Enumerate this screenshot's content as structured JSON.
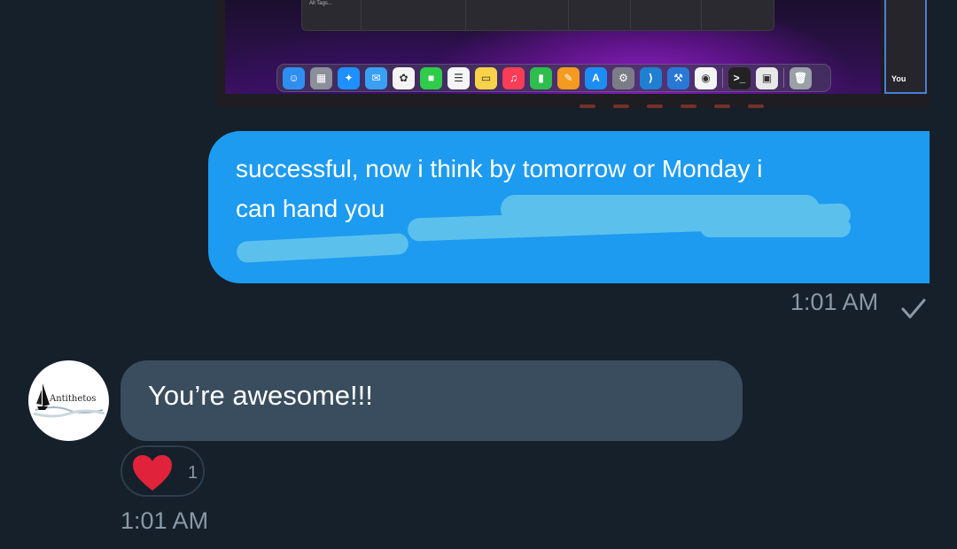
{
  "attachment": {
    "window_tag_text": "All Tags...",
    "thumbnail_label": "You",
    "dock_icons": [
      {
        "name": "finder-icon",
        "color": "#2f8ff0",
        "glyph": "☺"
      },
      {
        "name": "launchpad-icon",
        "color": "#8a8f99",
        "glyph": "▦"
      },
      {
        "name": "safari-icon",
        "color": "#1e90ff",
        "glyph": "✦"
      },
      {
        "name": "mail-icon",
        "color": "#3aa0f5",
        "glyph": "✉"
      },
      {
        "name": "photos-icon",
        "color": "#f4f4f4",
        "glyph": "✿"
      },
      {
        "name": "facetime-icon",
        "color": "#2ecc4a",
        "glyph": "■"
      },
      {
        "name": "reminders-icon",
        "color": "#f5f5f5",
        "glyph": "☰"
      },
      {
        "name": "notes-icon",
        "color": "#f7d24a",
        "glyph": "▭"
      },
      {
        "name": "music-icon",
        "color": "#fa3d56",
        "glyph": "♫"
      },
      {
        "name": "numbers-icon",
        "color": "#2dbe4e",
        "glyph": "▮"
      },
      {
        "name": "pages-icon",
        "color": "#f49a1e",
        "glyph": "✎"
      },
      {
        "name": "app-store-icon",
        "color": "#1c8ef2",
        "glyph": "A"
      },
      {
        "name": "system-settings-icon",
        "color": "#7a7d85",
        "glyph": "⚙"
      },
      {
        "name": "vscode-icon",
        "color": "#1f7fd0",
        "glyph": "⟩"
      },
      {
        "name": "xcode-icon",
        "color": "#2a78d6",
        "glyph": "⚒"
      },
      {
        "name": "chrome-icon",
        "color": "#f4f4f4",
        "glyph": "◉"
      },
      {
        "name": "terminal-icon",
        "color": "#222222",
        "glyph": ">_"
      },
      {
        "name": "preview-icon",
        "color": "#e8e8e8",
        "glyph": "▣"
      },
      {
        "name": "trash-icon",
        "color": "#9aa0a8",
        "glyph": "🗑"
      }
    ]
  },
  "outgoing": {
    "line1": "successful, now i think by tomorrow or Monday i",
    "line2_visible": "can hand you",
    "timestamp": "1:01 AM",
    "status_icon": "checkmark-icon",
    "bubble_color": "#1d9bf0",
    "redaction_color": "#5bc0ec"
  },
  "incoming": {
    "avatar_text": "Antithetos",
    "message": "You’re awesome!!!",
    "reaction_emoji": "heart-icon",
    "reaction_count": "1",
    "timestamp": "1:01 AM",
    "bubble_color": "#3a4d5e"
  },
  "theme": {
    "background": "#15202b",
    "muted_text": "#8b98a5",
    "heart_color": "#f91843"
  }
}
